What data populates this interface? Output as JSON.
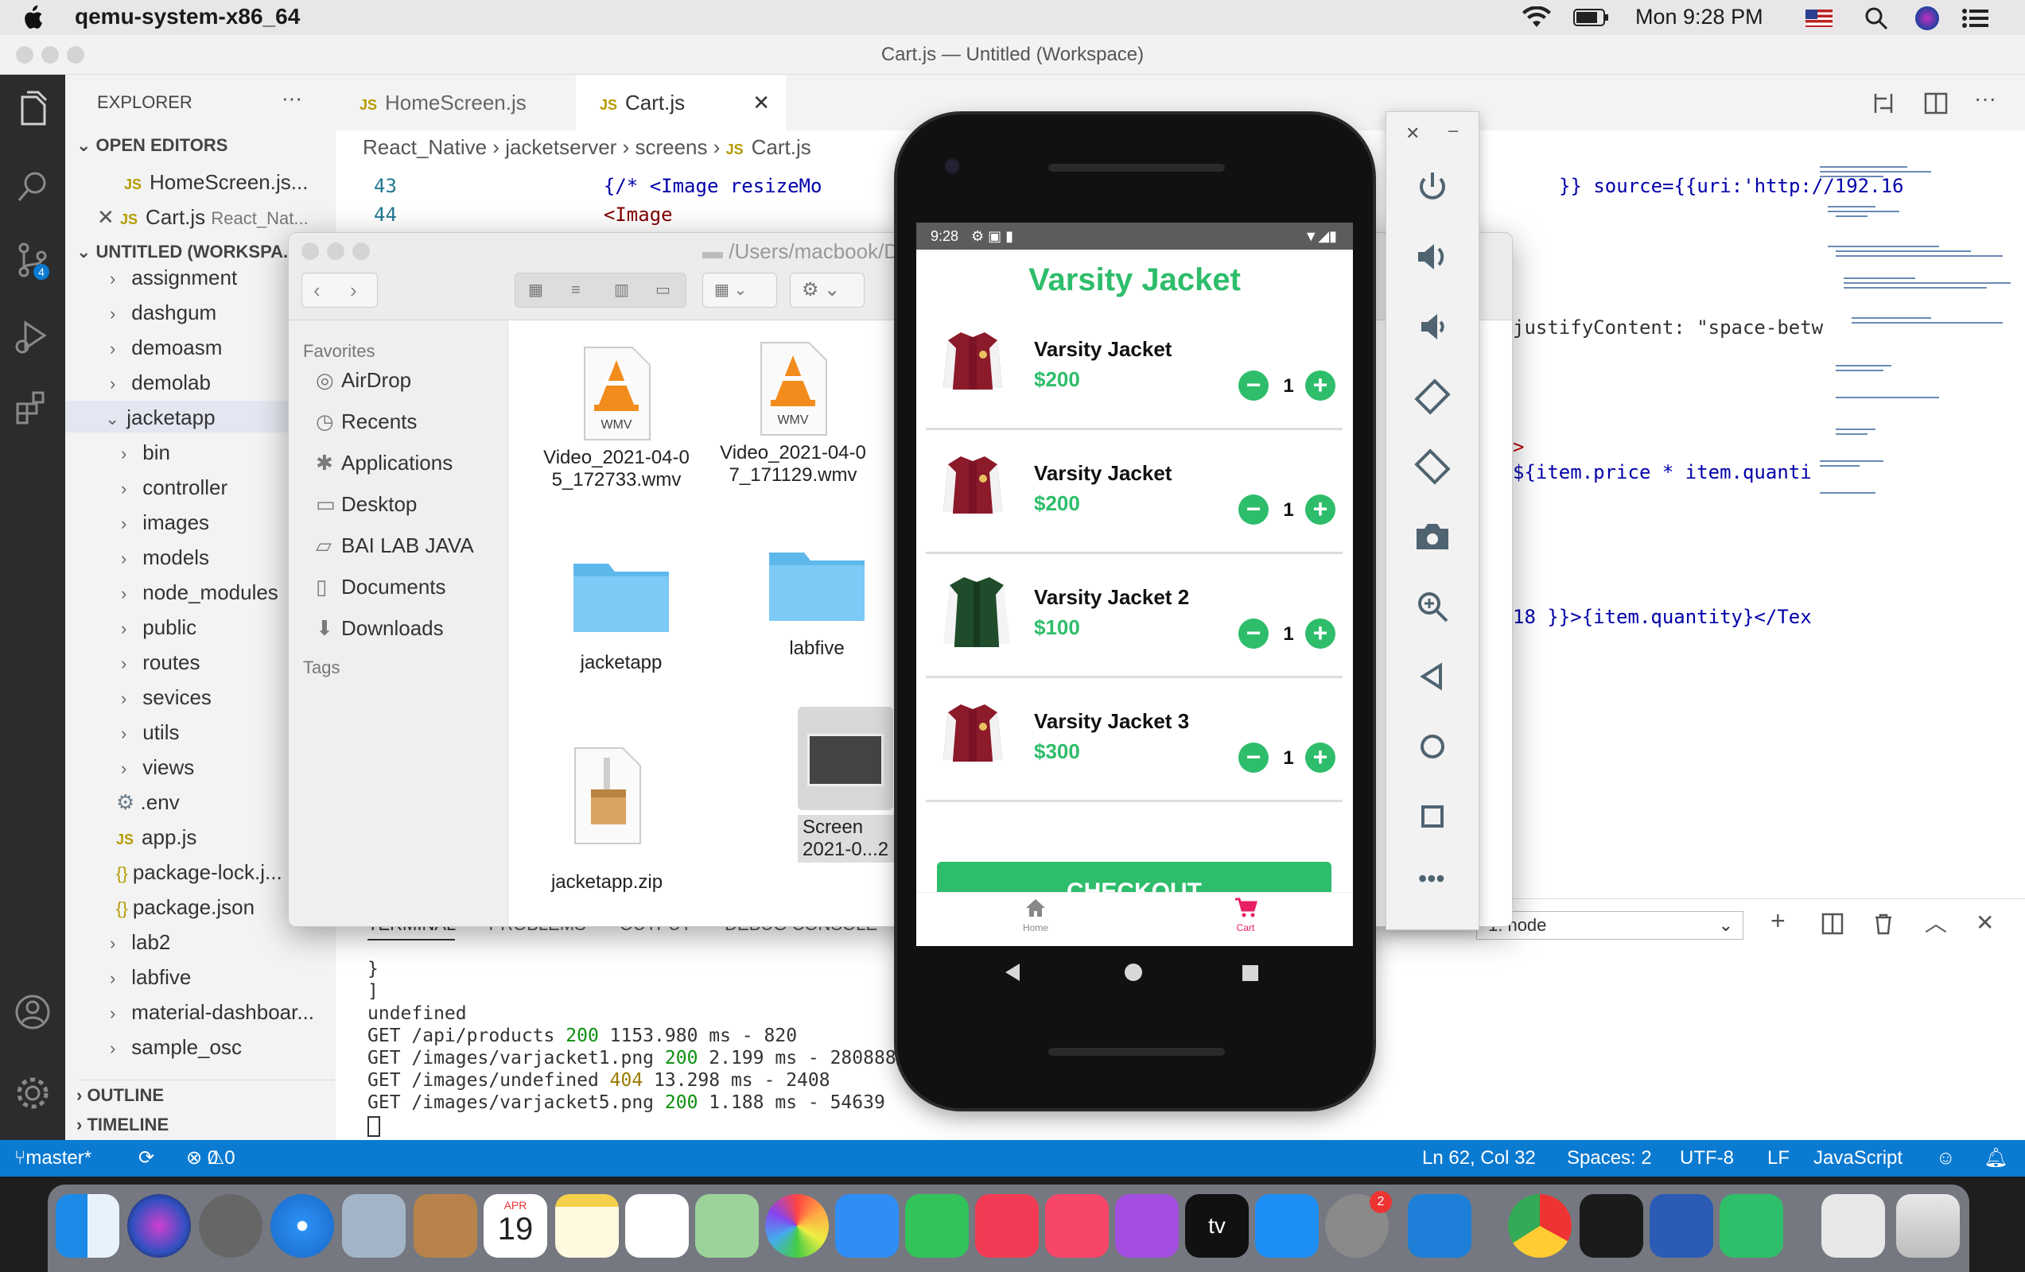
{
  "menubar": {
    "app_name": "qemu-system-x86_64",
    "clock": "Mon 9:28 PM"
  },
  "vscode": {
    "window_title": "Cart.js — Untitled (Workspace)",
    "explorer_label": "EXPLORER",
    "open_editors_label": "OPEN EDITORS",
    "open_editors": [
      {
        "name": "HomeScreen.js...",
        "hint": ""
      },
      {
        "name": "Cart.js",
        "hint": "React_Nat..."
      }
    ],
    "workspace_label": "UNTITLED (WORKSPA...",
    "tree": [
      "assignment",
      "dashgum",
      "demoasm",
      "demolab",
      "jacketapp",
      "bin",
      "controller",
      "images",
      "models",
      "node_modules",
      "public",
      "routes",
      "sevices",
      "utils",
      "views",
      ".env",
      "app.js",
      "package-lock.j...",
      "package.json",
      "lab2",
      "labfive",
      "material-dashboar...",
      "sample_osc"
    ],
    "outline_label": "OUTLINE",
    "timeline_label": "TIMELINE",
    "tabs": [
      "HomeScreen.js",
      "Cart.js"
    ],
    "breadcrumb": [
      "React_Native",
      "jacketserver",
      "screens",
      "Cart.js"
    ],
    "code_lines": [
      {
        "no": "43",
        "text": "{/* <Image resizeMo",
        "extra": "}} source={{uri:'http://192.16"
      },
      {
        "no": "44",
        "text": "<Image",
        "extra": ""
      }
    ],
    "right_code": [
      "justifyContent: \"space-betw",
      ">",
      "${item.price * item.quanti",
      "18 }}>{item.quantity}</Tex"
    ],
    "terminal_tabs": [
      "TERMINAL",
      "PROBLEMS",
      "OUTPUT",
      "DEBUG CONSOLE"
    ],
    "terminal_select": "1: node",
    "terminal_lines": [
      {
        "a": "  }",
        "b": "",
        "c": ""
      },
      {
        "a": "]",
        "b": "",
        "c": ""
      },
      {
        "a": "undefined",
        "b": "",
        "c": ""
      },
      {
        "a": "GET /api/products ",
        "b": "200",
        "c": " 1153.980 ms - 820"
      },
      {
        "a": "GET /images/varjacket1.png ",
        "b": "200",
        "c": " 2.199 ms - 280888"
      },
      {
        "a": "GET /images/undefined ",
        "b": "404",
        "c": " 13.298 ms - 2408"
      },
      {
        "a": "GET /images/varjacket5.png ",
        "b": "200",
        "c": " 1.188 ms - 54639"
      }
    ],
    "status": {
      "branch": "master*",
      "errors": "0",
      "warnings": "0",
      "position": "Ln 62, Col 32",
      "spaces": "Spaces: 2",
      "encoding": "UTF-8",
      "eol": "LF",
      "language": "JavaScript"
    }
  },
  "finder": {
    "path": "/Users/macbook/Do",
    "favorites_label": "Favorites",
    "favorites": [
      "AirDrop",
      "Recents",
      "Applications",
      "Desktop",
      "BAI LAB JAVA",
      "Documents",
      "Downloads"
    ],
    "tags_label": "Tags",
    "items": [
      {
        "l1": "Video_2021-04-0",
        "l2": "5_172733.wmv"
      },
      {
        "l1": "Video_2021-04-0",
        "l2": "7_171129.wmv"
      },
      {
        "l1": "jacketapp",
        "l2": ""
      },
      {
        "l1": "labfive",
        "l2": ""
      },
      {
        "l1": "jacketapp.zip",
        "l2": ""
      },
      {
        "l1": "Screen",
        "l2": "2021-0...2"
      }
    ],
    "wmv_badge": "WMV"
  },
  "phone": {
    "time": "9:28",
    "title": "Varsity Jacket",
    "items": [
      {
        "name": "Varsity Jacket",
        "price": "$200",
        "qty": "1",
        "color": "#8b1a2b"
      },
      {
        "name": "Varsity Jacket",
        "price": "$200",
        "qty": "1",
        "color": "#8b1a2b"
      },
      {
        "name": "Varsity Jacket 2",
        "price": "$100",
        "qty": "1",
        "color": "#1f4d2b"
      },
      {
        "name": "Varsity Jacket 3",
        "price": "$300",
        "qty": "1",
        "color": "#8b1a2b"
      }
    ],
    "checkout": "CHECKOUT",
    "nav_home": "Home",
    "nav_cart": "Cart",
    "accent": "#2ebd6b",
    "cart_accent": "#e91e63"
  },
  "dock": {
    "calendar_month": "APR",
    "calendar_day": "19",
    "settings_badge": "2",
    "tv_label": "tv"
  }
}
